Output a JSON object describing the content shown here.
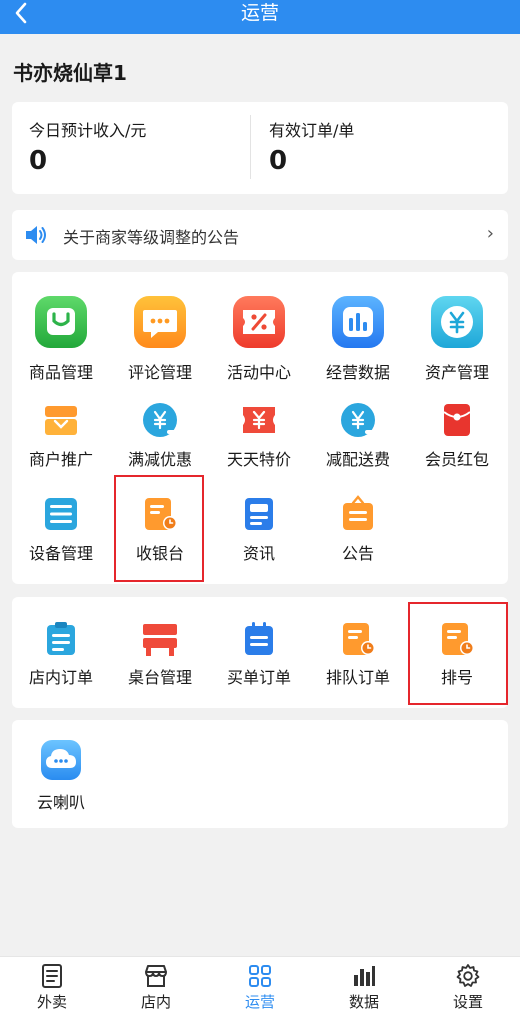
{
  "header": {
    "back_icon": "chevron-left-icon",
    "title": "运营"
  },
  "store": {
    "name": "书亦烧仙草1"
  },
  "stats": {
    "income_label": "今日预计收入/元",
    "income_value": "0",
    "orders_label": "有效订单/单",
    "orders_value": "0"
  },
  "notice": {
    "icon": "speaker-icon",
    "text": "关于商家等级调整的公告",
    "arrow": "›"
  },
  "grid_main": [
    {
      "label": "商品管理",
      "icon": "shopping-bag-icon"
    },
    {
      "label": "评论管理",
      "icon": "comment-icon"
    },
    {
      "label": "活动中心",
      "icon": "coupon-icon"
    },
    {
      "label": "经营数据",
      "icon": "bar-chart-icon"
    },
    {
      "label": "资产管理",
      "icon": "yen-coin-icon"
    },
    {
      "label": "商户推广",
      "icon": "promotion-icon"
    },
    {
      "label": "满减优惠",
      "icon": "yen-discount-icon"
    },
    {
      "label": "天天特价",
      "icon": "yen-ticket-icon"
    },
    {
      "label": "减配送费",
      "icon": "yen-delivery-icon"
    },
    {
      "label": "会员红包",
      "icon": "red-envelope-icon"
    },
    {
      "label": "设备管理",
      "icon": "device-list-icon"
    },
    {
      "label": "收银台",
      "icon": "cashier-icon"
    },
    {
      "label": "资讯",
      "icon": "news-icon"
    },
    {
      "label": "公告",
      "icon": "announcement-icon"
    }
  ],
  "grid_orders": [
    {
      "label": "店内订单",
      "icon": "clipboard-icon"
    },
    {
      "label": "桌台管理",
      "icon": "table-icon"
    },
    {
      "label": "买单订单",
      "icon": "calendar-order-icon"
    },
    {
      "label": "排队订单",
      "icon": "queue-order-icon"
    },
    {
      "label": "排号",
      "icon": "queue-number-icon"
    }
  ],
  "grid_extra": [
    {
      "label": "云喇叭",
      "icon": "cloud-speaker-icon"
    }
  ],
  "tabs": [
    {
      "label": "外卖",
      "icon": "list-doc-icon"
    },
    {
      "label": "店内",
      "icon": "store-icon"
    },
    {
      "label": "运营",
      "icon": "grid-icon"
    },
    {
      "label": "数据",
      "icon": "bar-stats-icon"
    },
    {
      "label": "设置",
      "icon": "gear-icon"
    }
  ],
  "colors": {
    "primary": "#2d8cf0",
    "highlight": "#e5262c"
  }
}
